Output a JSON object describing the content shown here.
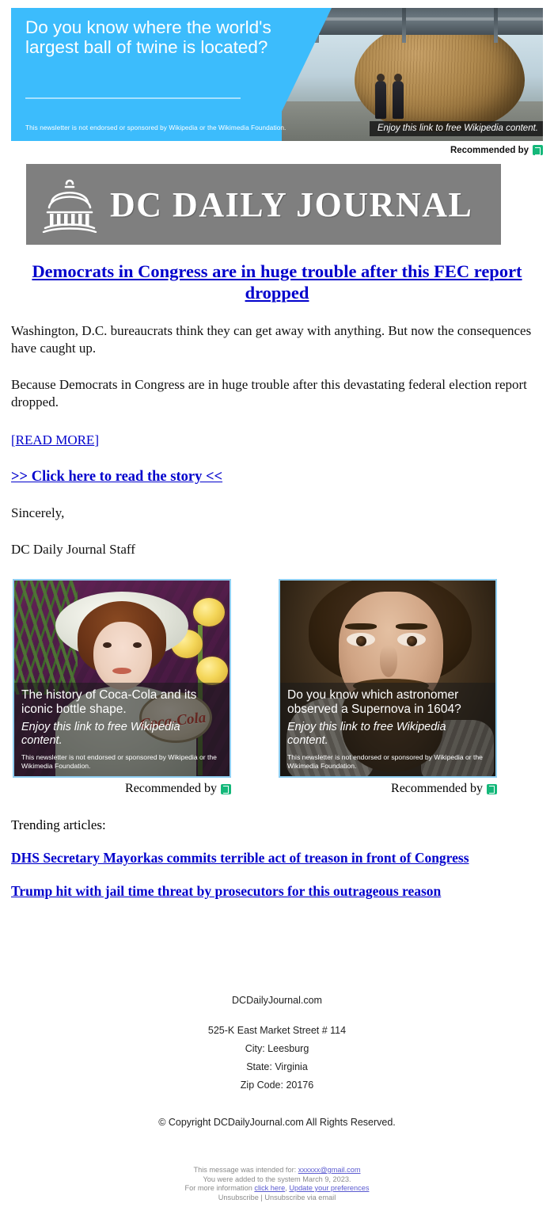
{
  "top_ad": {
    "headline": "Do you know where the world's largest ball of twine is located?",
    "disclaimer": "This newsletter is not endorsed or sponsored by Wikipedia or the Wikimedia Foundation.",
    "caption": "Enjoy this link to free Wikipedia content.",
    "recommended_by": "Recommended by",
    "logo_name": "outbrain-logo",
    "accent_color": "#3cbcfc",
    "logo_color": "#14b87a"
  },
  "masthead": {
    "title": "DC DAILY JOURNAL",
    "icon": "capitol-dome-icon",
    "background_color": "#7f7f7f"
  },
  "article": {
    "headline": "Democrats in Congress are in huge trouble after this FEC report dropped",
    "paragraph_1": "Washington, D.C. bureaucrats think they can get away with anything. But now the consequences have caught up.",
    "paragraph_2": "Because Democrats in Congress are in huge trouble after this devastating federal election report dropped.",
    "read_more_open": "[",
    "read_more_label": "READ MORE",
    "read_more_close": "]",
    "click_here_label": ">> Click here to read the story <<",
    "signoff": "Sincerely,",
    "signature": "DC Daily Journal Staff",
    "link_color": "#0000cc"
  },
  "ads": [
    {
      "name": "coca-cola-ad",
      "title": "The history of Coca-Cola and its iconic bottle shape.",
      "subtitle": "Enjoy this link to free Wikipedia content.",
      "disclaimer": "This newsletter is not endorsed or sponsored by Wikipedia or the Wikimedia Foundation.",
      "recommended_by": "Recommended by",
      "brand_script": "Coca-Cola"
    },
    {
      "name": "supernova-ad",
      "title": "Do you know which astronomer observed a Supernova in 1604?",
      "subtitle": "Enjoy this link to free Wikipedia content.",
      "disclaimer": "This newsletter is not endorsed or sponsored by Wikipedia or the Wikimedia Foundation.",
      "recommended_by": "Recommended by",
      "brand_script": ""
    }
  ],
  "trending": {
    "label": "Trending articles:",
    "items": [
      "DHS Secretary Mayorkas commits terrible act of treason in front of Congress",
      "Trump hit with jail time threat by prosecutors for this outrageous reason"
    ]
  },
  "footer": {
    "site": "DCDailyJournal.com",
    "address_line": "525-K East Market Street # 114",
    "city": "City: Leesburg",
    "state": "State: Virginia",
    "zip": "Zip Code: 20176",
    "copyright": "© Copyright DCDailyJournal.com All Rights Reserved.",
    "legal": {
      "intended_prefix": "This message was intended for:",
      "intended_email": "xxxxxx@gmail.com",
      "added_line": "You were added to the system March 9, 2023.",
      "more_info_prefix": "For more information",
      "click_here": "click here",
      "separator": ",",
      "update_prefs": "Update your preferences",
      "unsubscribe": "Unsubscribe",
      "pipe": "|",
      "unsubscribe_email": "Unsubscribe via email"
    }
  }
}
